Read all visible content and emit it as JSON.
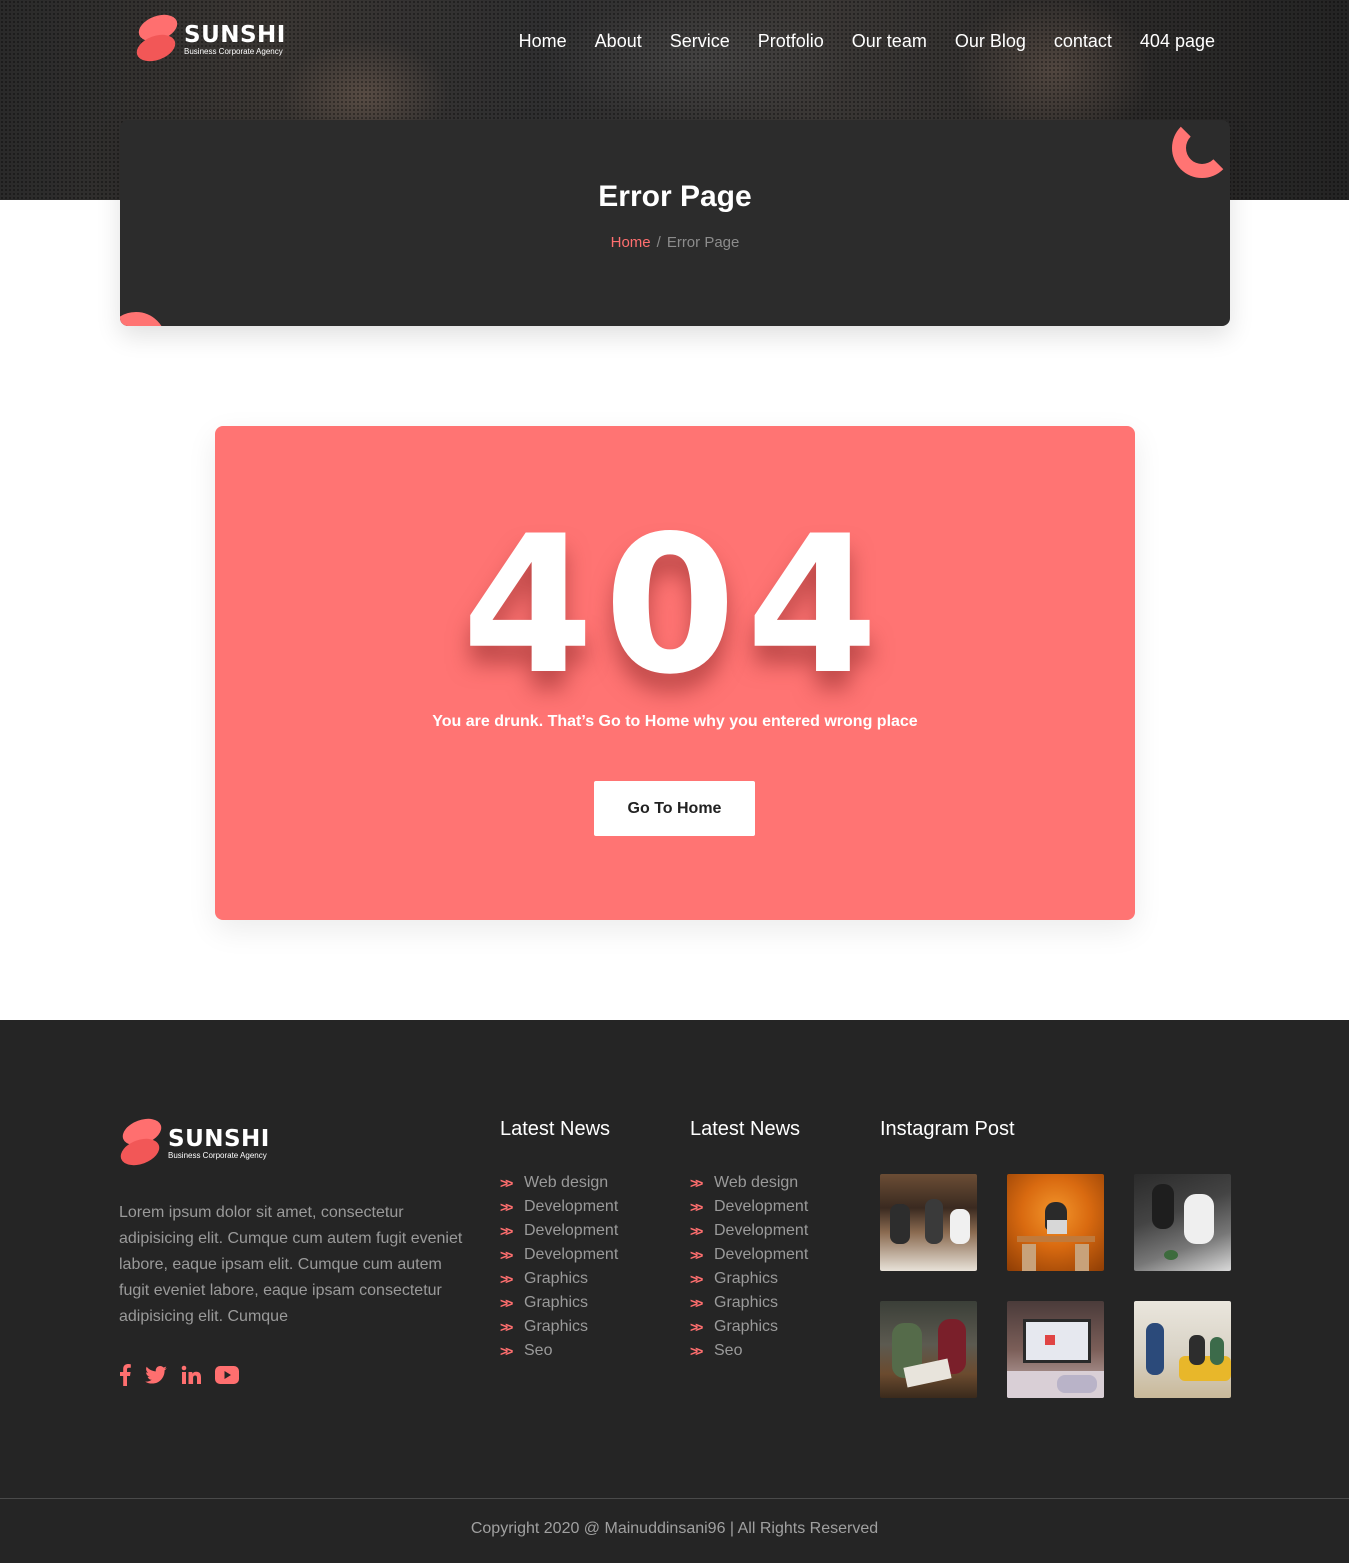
{
  "brand": {
    "name": "SUNSHI",
    "tagline": "Business Corporate Agency"
  },
  "nav": [
    "Home",
    "About",
    "Service",
    "Protfolio",
    "Our team",
    "Our Blog",
    "contact",
    "404 page"
  ],
  "page_header": {
    "title": "Error Page",
    "breadcrumb_home": "Home",
    "breadcrumb_sep": "/",
    "breadcrumb_current": "Error Page"
  },
  "error": {
    "code": "404",
    "message": "You are drunk. That’s Go to Home why you entered wrong place",
    "button_label": "Go To Home"
  },
  "footer": {
    "about": "Lorem ipsum dolor sit amet, consectetur adipisicing elit. Cumque cum autem fugit eveniet labore, eaque ipsam elit. Cumque cum autem fugit eveniet labore, eaque ipsam consectetur adipisicing elit. Cumque",
    "social_icons": [
      "facebook-icon",
      "twitter-icon",
      "linkedin-icon",
      "youtube-icon"
    ],
    "news1": {
      "title": "Latest News",
      "items": [
        "Web design",
        "Development",
        "Development",
        "Development",
        "Graphics",
        "Graphics",
        "Graphics",
        "Seo"
      ]
    },
    "news2": {
      "title": "Latest News",
      "items": [
        "Web design",
        "Development",
        "Development",
        "Development",
        "Graphics",
        "Graphics",
        "Graphics",
        "Seo"
      ]
    },
    "instagram": {
      "title": "Instagram Post",
      "photos": [
        "office-photo",
        "laptop-orange-photo",
        "meeting-photo",
        "team-photo",
        "screen-photo",
        "lounge-photo"
      ]
    },
    "copyright": "Copyright 2020 @ Mainuddinsani96 | All Rights Reserved"
  },
  "colors": {
    "accent": "#ff7473",
    "dark": "#2c2c2c",
    "footer_bg": "#252525"
  }
}
